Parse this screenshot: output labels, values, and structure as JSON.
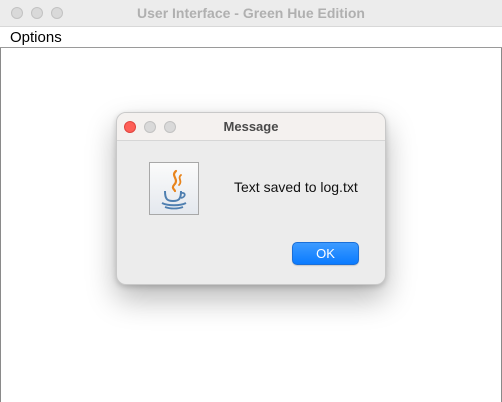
{
  "window": {
    "title": "User Interface - Green Hue Edition"
  },
  "menubar": {
    "items": [
      {
        "label": "Options"
      }
    ]
  },
  "dialog": {
    "title": "Message",
    "icon": "java-coffee-cup-icon",
    "message": "Text saved to log.txt",
    "ok_label": "OK",
    "accent_color": "#0a7bff"
  }
}
